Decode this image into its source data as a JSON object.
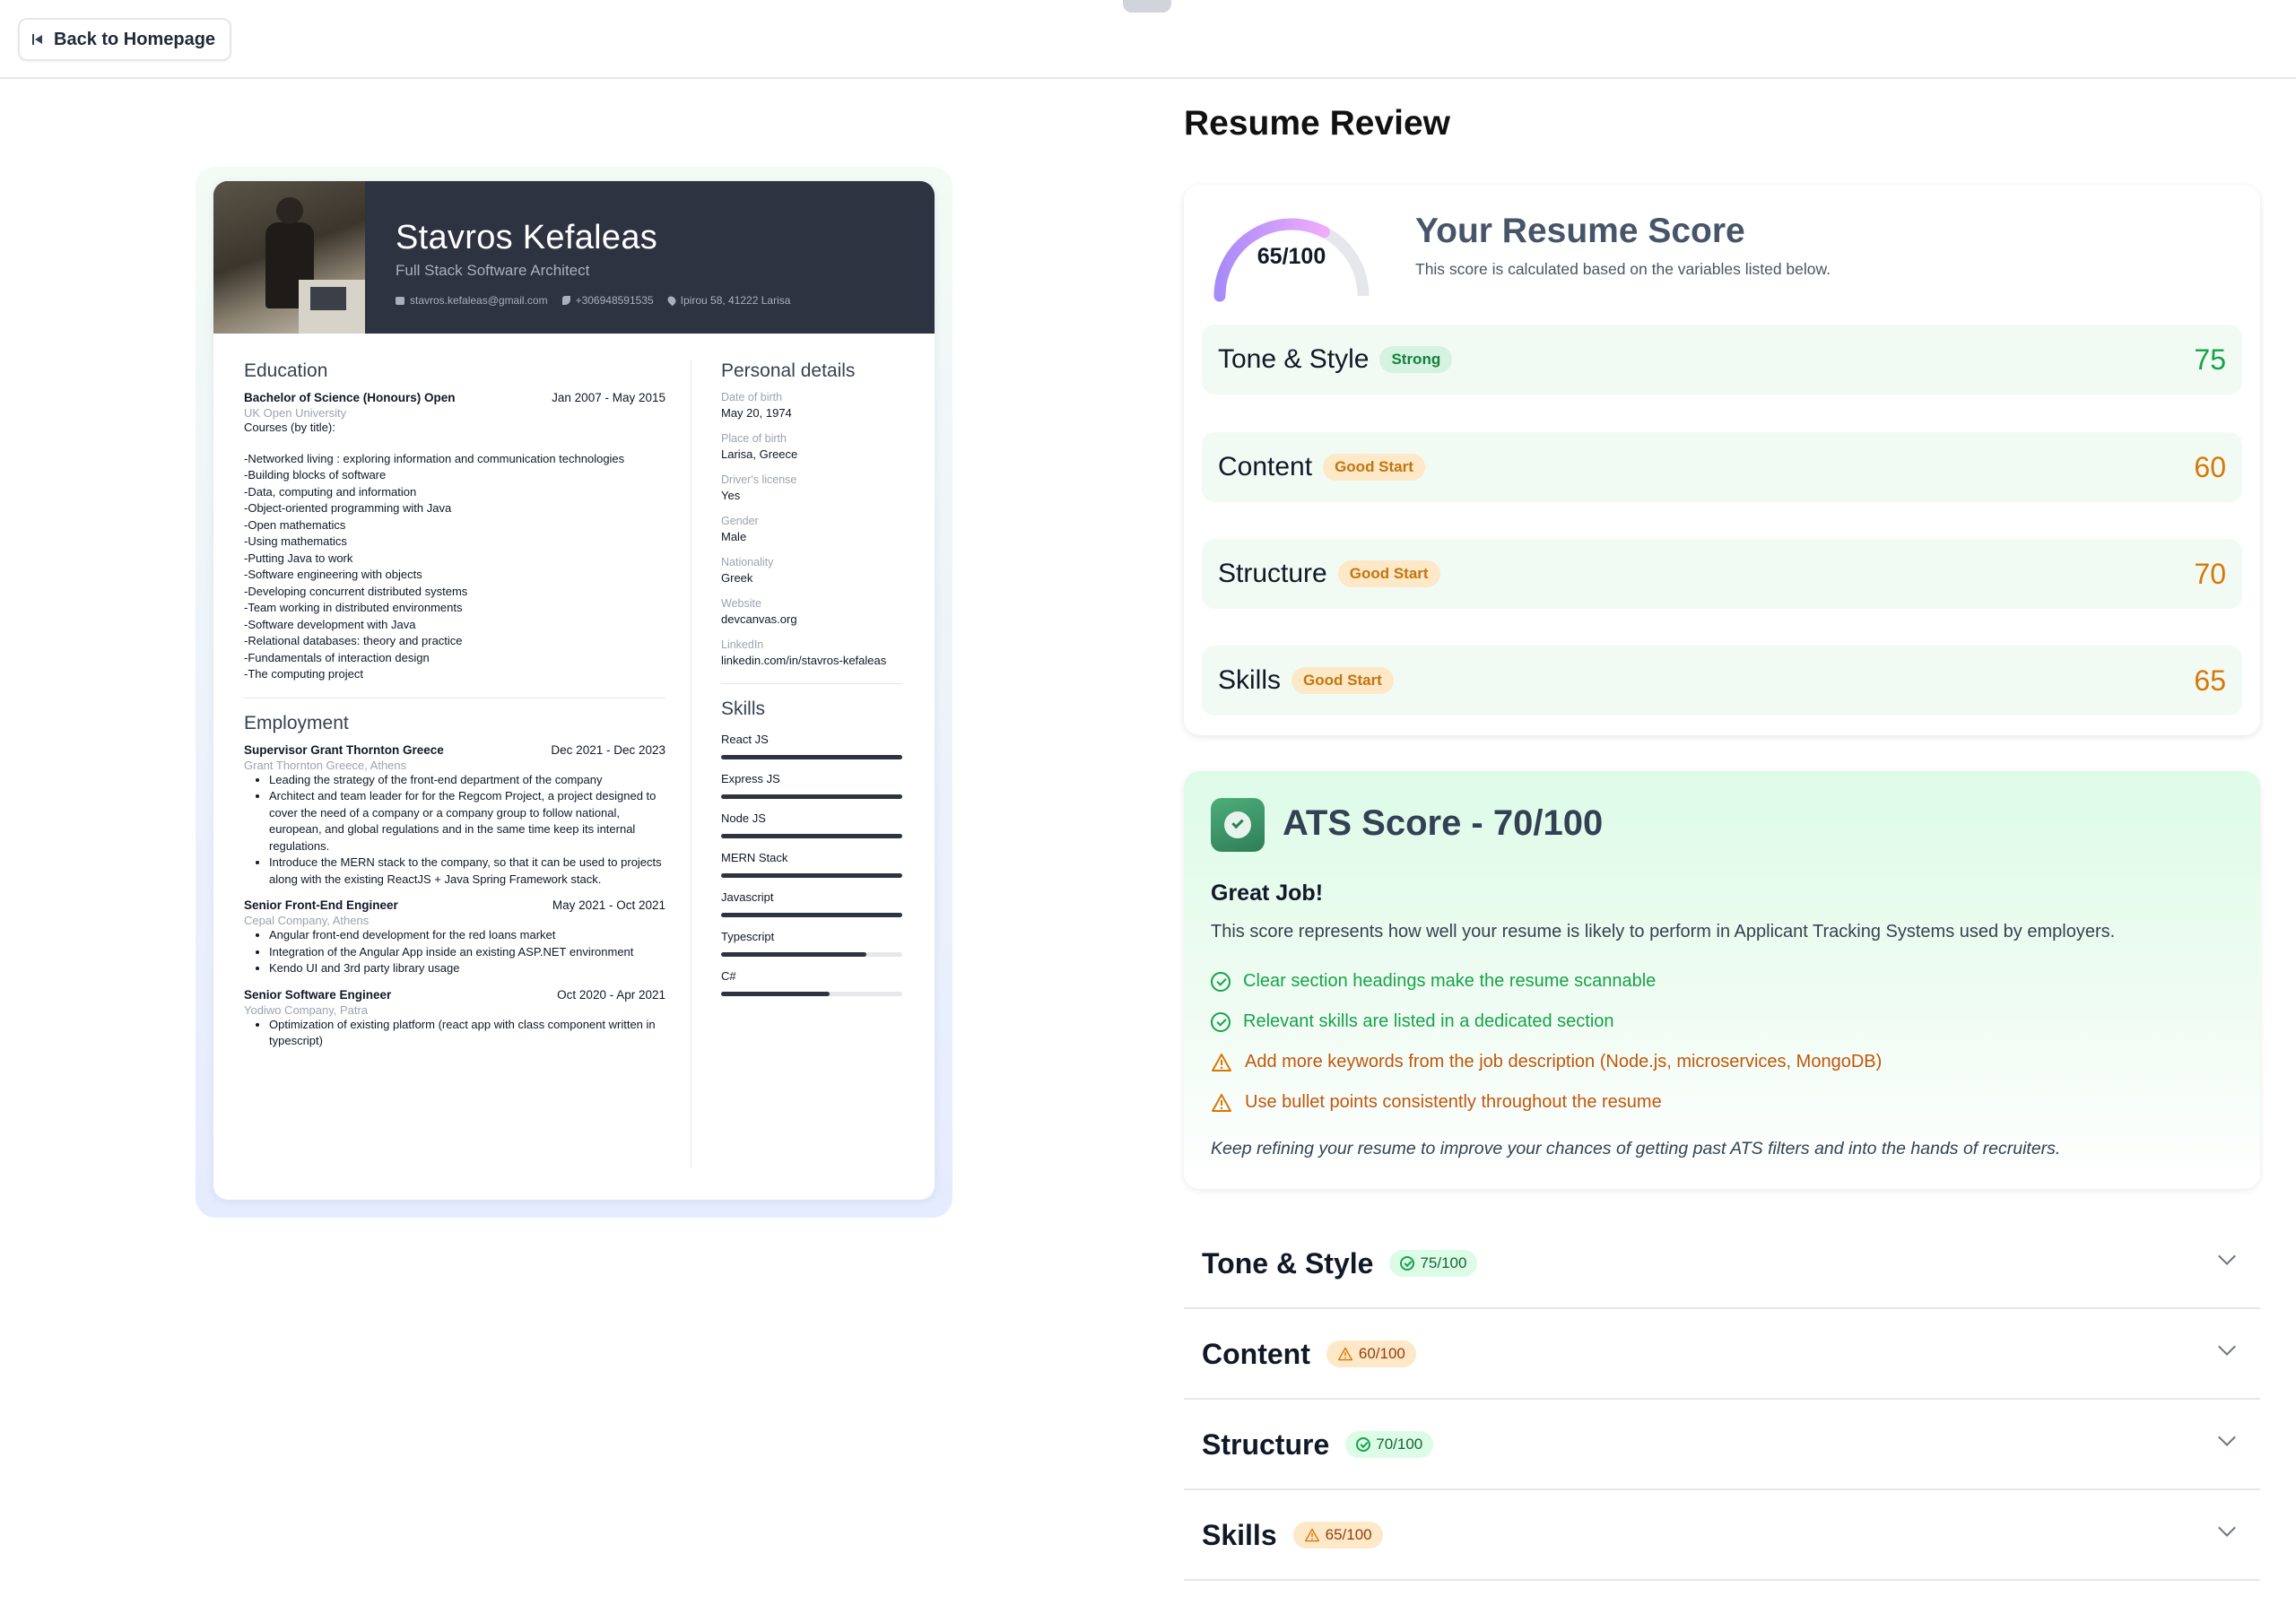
{
  "topbar": {
    "back_label": "Back to Homepage"
  },
  "resume": {
    "name": "Stavros Kefaleas",
    "title": "Full Stack Software Architect",
    "email": "stavros.kefaleas@gmail.com",
    "phone": "+306948591535",
    "address": "Ipirou 58, 41222 Larisa",
    "education": {
      "heading": "Education",
      "degree": "Bachelor of Science (Honours) Open",
      "dates": "Jan 2007 - May 2015",
      "school": "UK Open University",
      "courses_label": "Courses (by title):",
      "courses": [
        "-Networked living : exploring information and communication technologies",
        "-Building blocks of software",
        "-Data, computing and information",
        "-Object-oriented programming with Java",
        "-Open mathematics",
        "-Using mathematics",
        "-Putting Java to work",
        "-Software engineering with objects",
        "-Developing concurrent distributed systems",
        "-Team working in distributed environments",
        "-Software development with Java",
        "-Relational databases: theory and practice",
        "-Fundamentals of interaction design",
        "-The computing project"
      ]
    },
    "employment": {
      "heading": "Employment",
      "jobs": [
        {
          "role": "Supervisor Grant Thornton Greece",
          "dates": "Dec 2021 - Dec 2023",
          "company": "Grant Thornton Greece, Athens",
          "bullets": [
            "Leading the strategy of the front-end department of the company",
            "Architect and team leader for for the Regcom Project, a project designed to cover the need of a company or a company group to follow national, european, and global regulations and in the same time keep its internal regulations.",
            "Introduce the MERN stack to the company, so that it can be used to projects along with the existing ReactJS + Java Spring Framework stack."
          ]
        },
        {
          "role": "Senior Front-End Engineer",
          "dates": "May 2021 - Oct 2021",
          "company": "Cepal Company, Athens",
          "bullets": [
            "Angular front-end development for the red loans market",
            "Integration of the Angular App inside an existing ASP.NET environment",
            "Kendo UI and 3rd party library usage"
          ]
        },
        {
          "role": "Senior Software Engineer",
          "dates": "Oct 2020 - Apr 2021",
          "company": "Yodiwo Company, Patra",
          "bullets": [
            "Optimization of existing platform (react app with class component written in typescript)"
          ]
        }
      ]
    },
    "personal": {
      "heading": "Personal details",
      "items": [
        {
          "label": "Date of birth",
          "value": "May 20, 1974"
        },
        {
          "label": "Place of birth",
          "value": "Larisa, Greece"
        },
        {
          "label": "Driver's license",
          "value": "Yes"
        },
        {
          "label": "Gender",
          "value": "Male"
        },
        {
          "label": "Nationality",
          "value": "Greek"
        },
        {
          "label": "Website",
          "value": "devcanvas.org"
        },
        {
          "label": "LinkedIn",
          "value": "linkedin.com/in/stavros-kefaleas"
        }
      ]
    },
    "skills": {
      "heading": "Skills",
      "items": [
        {
          "name": "React JS",
          "level": 1.0
        },
        {
          "name": "Express JS",
          "level": 1.0
        },
        {
          "name": "Node JS",
          "level": 1.0
        },
        {
          "name": "MERN Stack",
          "level": 1.0
        },
        {
          "name": "Javascript",
          "level": 1.0
        },
        {
          "name": "Typescript",
          "level": 0.8
        },
        {
          "name": "C#",
          "level": 0.6
        }
      ]
    }
  },
  "review": {
    "heading": "Resume Review",
    "overall_score": 65,
    "overall_label": "65/100",
    "score_title": "Your Resume Score",
    "score_subtitle": "This score is calculated based on the variables listed below.",
    "categories": [
      {
        "name": "Tone & Style",
        "badge": "Strong",
        "score": "75",
        "status": "strong"
      },
      {
        "name": "Content",
        "badge": "Good Start",
        "score": "60",
        "status": "good"
      },
      {
        "name": "Structure",
        "badge": "Good Start",
        "score": "70",
        "status": "good"
      },
      {
        "name": "Skills",
        "badge": "Good Start",
        "score": "65",
        "status": "good"
      }
    ]
  },
  "ats": {
    "title": "ATS Score - 70/100",
    "headline": "Great Job!",
    "description": "This score represents how well your resume is likely to perform in Applicant Tracking Systems used by employers.",
    "tips": [
      {
        "type": "good",
        "text": "Clear section headings make the resume scannable"
      },
      {
        "type": "good",
        "text": "Relevant skills are listed in a dedicated section"
      },
      {
        "type": "improve",
        "text": "Add more keywords from the job description (Node.js, microservices, MongoDB)"
      },
      {
        "type": "improve",
        "text": "Use bullet points consistently throughout the resume"
      }
    ],
    "footer": "Keep refining your resume to improve your chances of getting past ATS filters and into the hands of recruiters."
  },
  "details": [
    {
      "title": "Tone & Style",
      "badge": "75/100",
      "status": "good"
    },
    {
      "title": "Content",
      "badge": "60/100",
      "status": "warn"
    },
    {
      "title": "Structure",
      "badge": "70/100",
      "status": "good"
    },
    {
      "title": "Skills",
      "badge": "65/100",
      "status": "warn"
    }
  ],
  "colors": {
    "header_dark": "#2d3340",
    "strong_green": "#16a34a",
    "warn_orange": "#d97706",
    "gauge_start": "#a78bfa",
    "gauge_end": "#f0abfc"
  }
}
